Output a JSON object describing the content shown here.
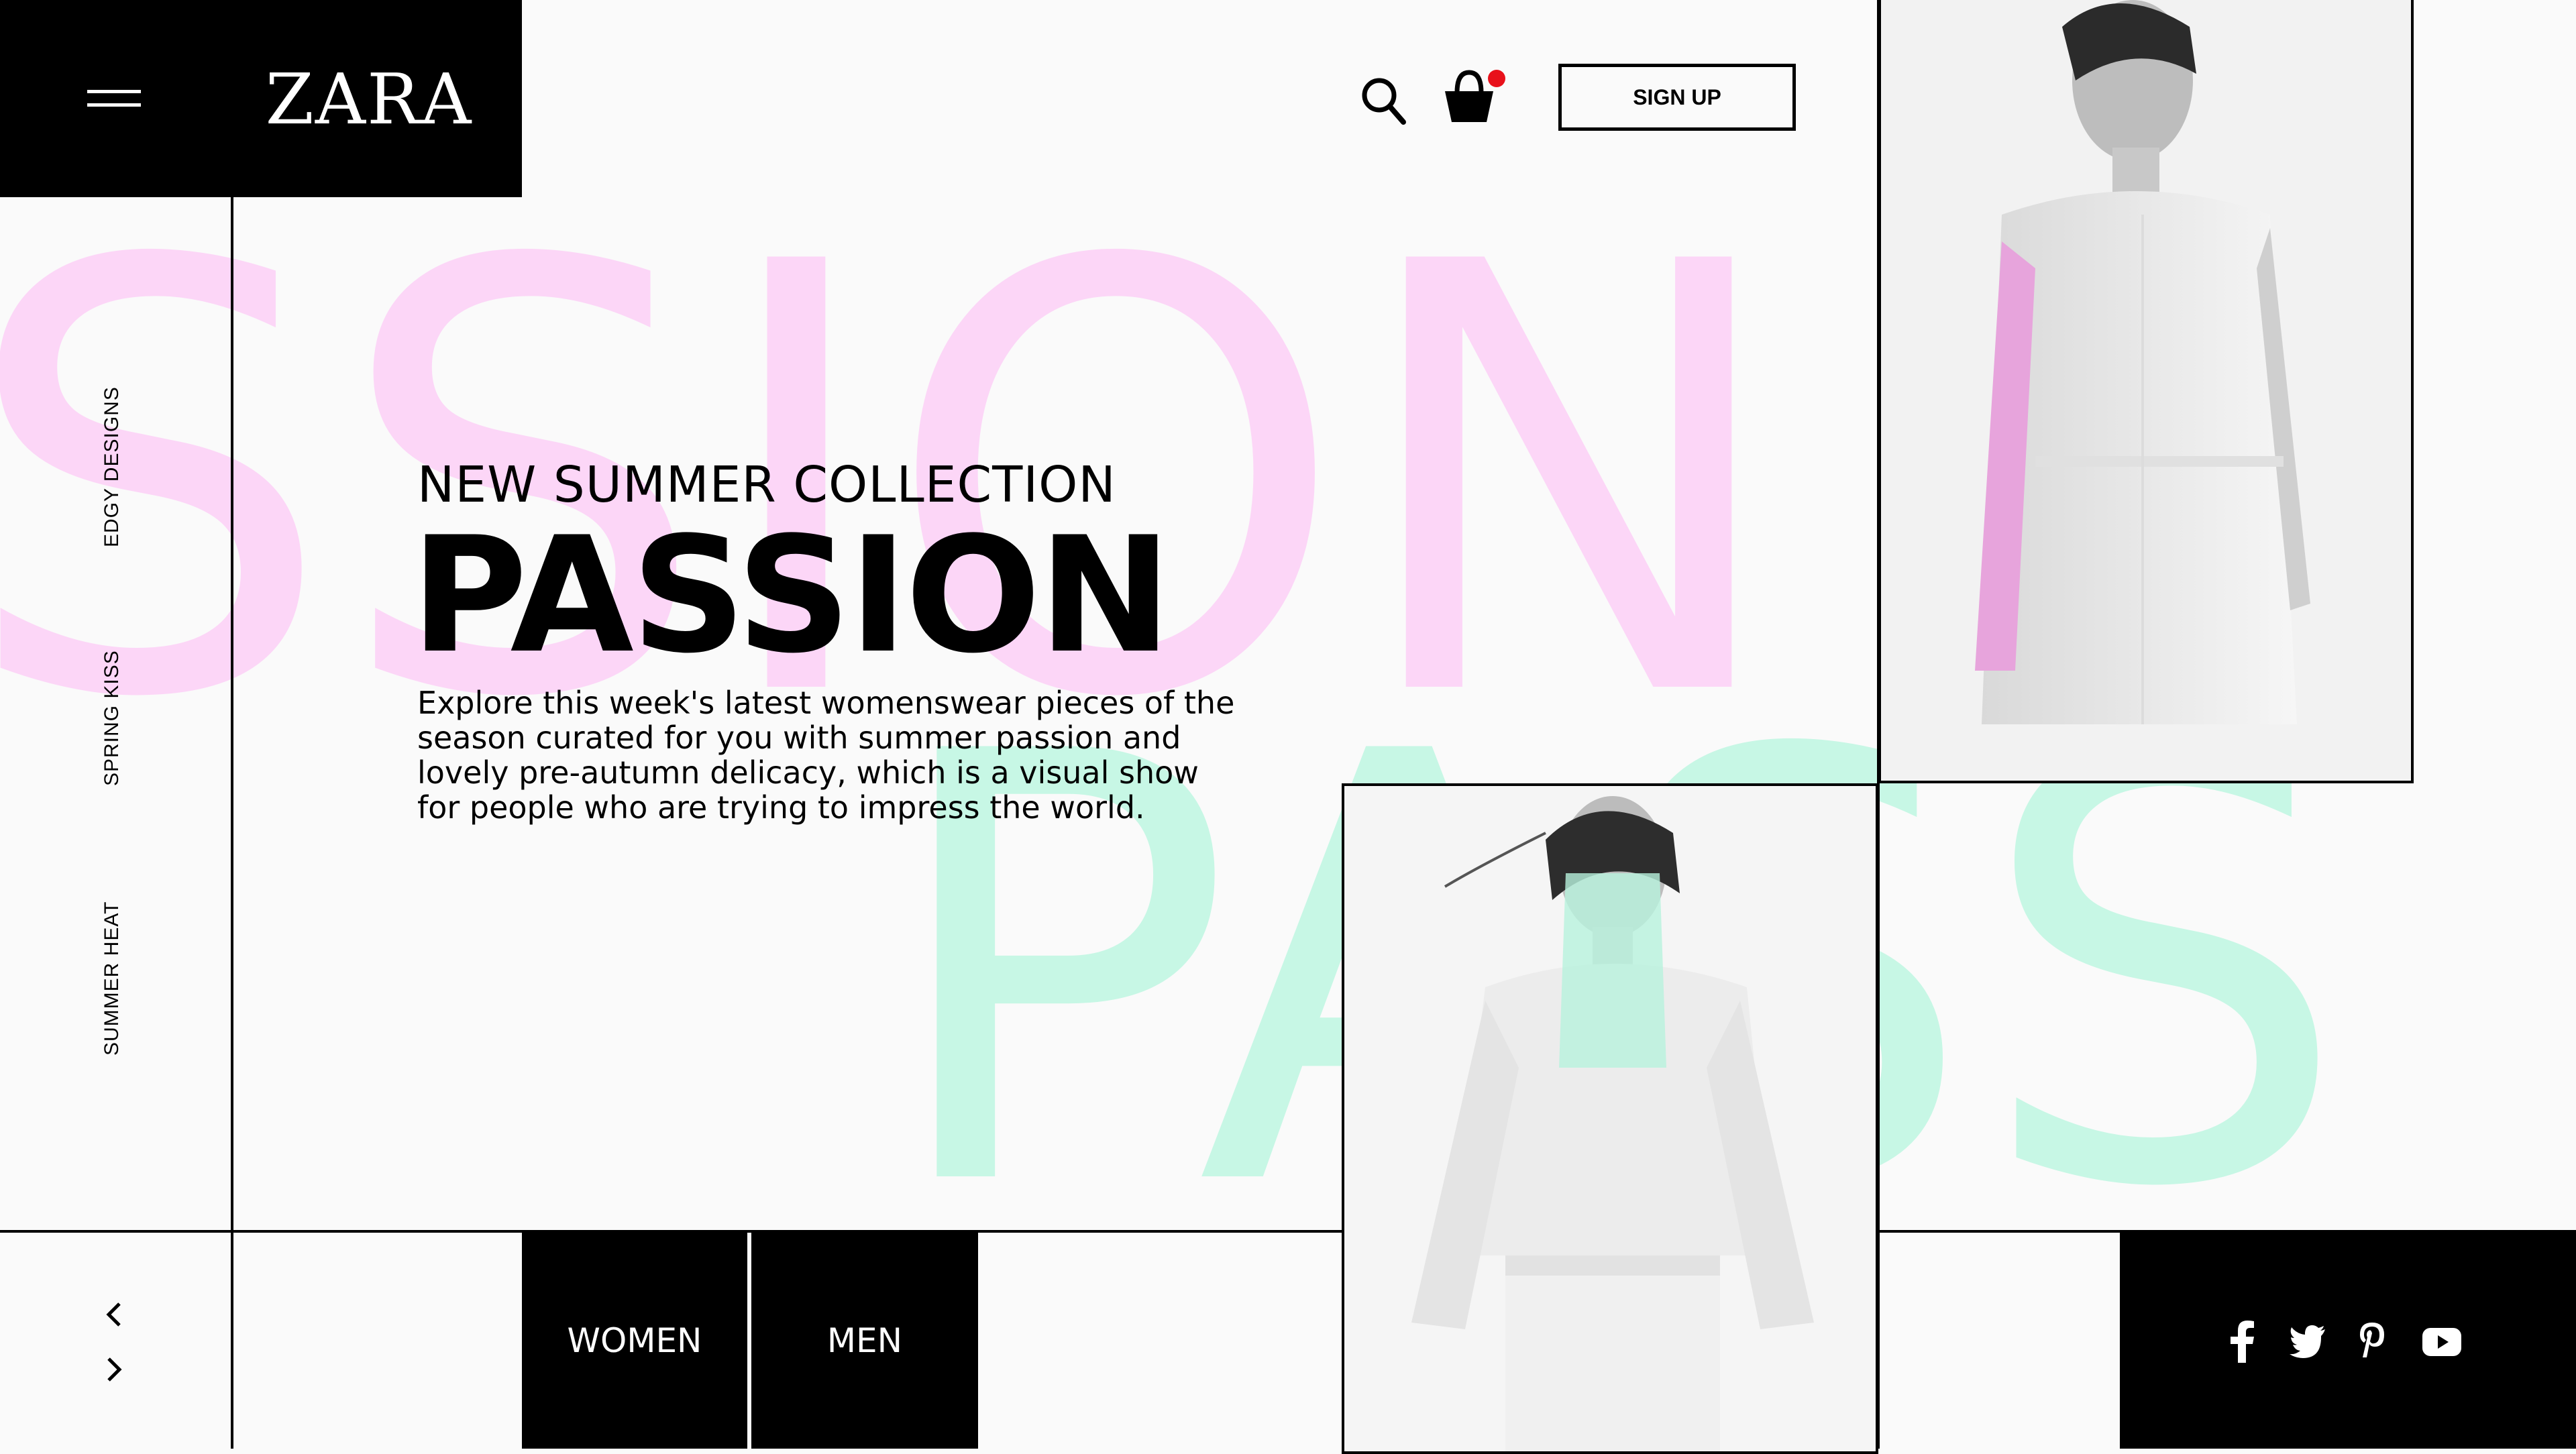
{
  "brand": {
    "logo": "ZARA"
  },
  "header": {
    "signup_label": "SIGN UP",
    "cart_has_notification": true
  },
  "background_words": {
    "top": "SSION",
    "bottom": "PASS",
    "top_color": "#fcd6f7",
    "bottom_color": "#c7f7e5"
  },
  "side_nav": {
    "items": [
      {
        "label": "EDGY DESIGNS"
      },
      {
        "label": "SPRING KISS"
      },
      {
        "label": "SUMMER HEAT"
      }
    ]
  },
  "hero": {
    "subtitle": "NEW SUMMER COLLECTION",
    "title": "PASSION",
    "description": "Explore this week's latest womenswear pieces of the season curated for you with summer passion and lovely pre-autumn delicacy, which is a visual show for people who are trying to impress the world."
  },
  "categories": {
    "women": "WOMEN",
    "men": "MEN"
  },
  "social": [
    "facebook-icon",
    "twitter-icon",
    "pinterest-icon",
    "youtube-icon"
  ],
  "icons": {
    "menu": "hamburger-menu-icon",
    "search": "search-icon",
    "cart": "shopping-basket-icon",
    "prev": "chevron-left-icon",
    "next": "chevron-right-icon"
  },
  "colors": {
    "accent_black": "#000000",
    "notification_dot": "#e8111b",
    "pink": "#fcd6f7",
    "mint": "#c7f7e5"
  }
}
